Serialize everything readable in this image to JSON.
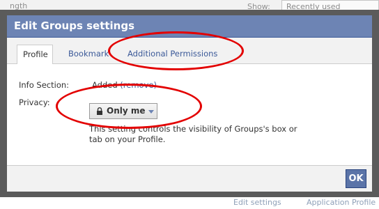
{
  "background_page": {
    "top_left_text": "ngth",
    "show_label": "Show:",
    "show_select_value": "Recently used",
    "bottom_edit_link": "Edit settings",
    "bottom_app_link": "Application Profile"
  },
  "dialog": {
    "title": "Edit Groups settings",
    "tabs": [
      {
        "label": "Profile",
        "active": true
      },
      {
        "label": "Bookmark",
        "active": false
      },
      {
        "label": "Additional Permissions",
        "active": false
      }
    ],
    "info_section": {
      "label": "Info Section:",
      "value": "Added",
      "remove_link": "(remove)"
    },
    "privacy": {
      "label": "Privacy:",
      "button_label": "Only me",
      "icon": "lock-icon",
      "description": "This setting controls the visibility of Groups's box or tab on your Profile."
    },
    "ok_label": "OK"
  },
  "colors": {
    "header": "#6d84b4",
    "link": "#3b5998",
    "annotation": "#e30000",
    "frame": "#5b5b5b"
  }
}
